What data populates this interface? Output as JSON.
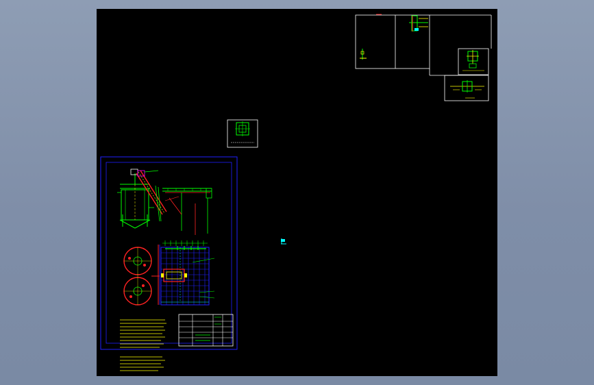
{
  "app": {
    "type": "CAD model-space viewport"
  },
  "colors": {
    "canvas": "#000000",
    "frame_white": "#ffffff",
    "frame_blue": "#2020ff",
    "green": "#00ff00",
    "red": "#ff2020",
    "yellow": "#ffff00",
    "cyan": "#00e5ff",
    "magenta": "#ff40ff"
  },
  "drawings": [
    {
      "id": "main-assembly",
      "views": [
        "tank-elevation",
        "conveyor-elevation",
        "tank-plan-circles",
        "grid-plan"
      ]
    },
    {
      "id": "detail-sheet-top-right"
    },
    {
      "id": "detail-small-center"
    },
    {
      "id": "detail-right-lower"
    }
  ],
  "icons": [
    "ucs-icon"
  ]
}
